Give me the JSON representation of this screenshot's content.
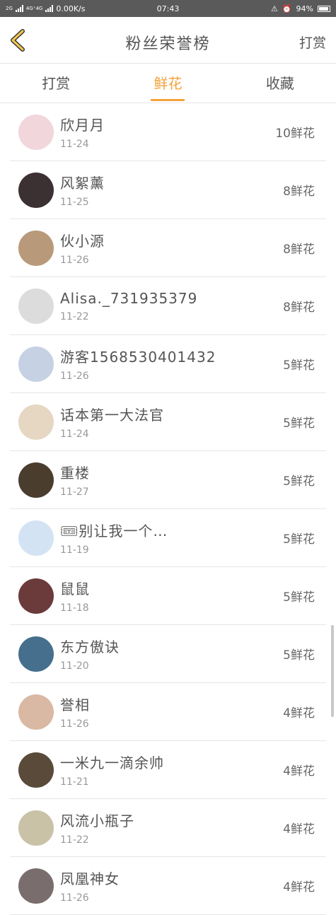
{
  "status_bar": {
    "left_net1": "2G",
    "left_net2": "4G⁺4G",
    "speed": "0.00K/s",
    "time": "07:43",
    "battery": "94%"
  },
  "header": {
    "title": "粉丝荣誉榜",
    "right_link": "打赏"
  },
  "tabs": [
    {
      "label": "打赏",
      "active": false
    },
    {
      "label": "鲜花",
      "active": true
    },
    {
      "label": "收藏",
      "active": false
    }
  ],
  "accent_color": "#f3a23a",
  "rows": [
    {
      "name": "欣月月",
      "date": "11-24",
      "count": "10鲜花",
      "avatar": "#f1d6dc"
    },
    {
      "name": "风絮薰",
      "date": "11-25",
      "count": "8鲜花",
      "avatar": "#3b3032"
    },
    {
      "name": "伙小源",
      "date": "11-26",
      "count": "8鲜花",
      "avatar": "#b89a7a"
    },
    {
      "name": "Alisa._731935379",
      "date": "11-22",
      "count": "8鲜花",
      "avatar": "#dcdcdc"
    },
    {
      "name": "游客1568530401432",
      "date": "11-26",
      "count": "5鲜花",
      "avatar": "#c6d2e3"
    },
    {
      "name": "话本第一大法官",
      "date": "11-24",
      "count": "5鲜花",
      "avatar": "#e6d7c3"
    },
    {
      "name": "重楼",
      "date": "11-27",
      "count": "5鲜花",
      "avatar": "#4a3d2e"
    },
    {
      "name": "🎟别让我一个…",
      "date": "11-19",
      "count": "5鲜花",
      "avatar": "#d3e3f3"
    },
    {
      "name": "鼠鼠",
      "date": "11-18",
      "count": "5鲜花",
      "avatar": "#6b3a3a"
    },
    {
      "name": "东方傲诀",
      "date": "11-20",
      "count": "5鲜花",
      "avatar": "#456f8c"
    },
    {
      "name": "誉相",
      "date": "11-26",
      "count": "4鲜花",
      "avatar": "#d9b9a3"
    },
    {
      "name": "一米九一滴余帅",
      "date": "11-21",
      "count": "4鲜花",
      "avatar": "#5a4a3a"
    },
    {
      "name": "风流小瓶子",
      "date": "11-22",
      "count": "4鲜花",
      "avatar": "#c9c2a7"
    },
    {
      "name": "凤凰神女",
      "date": "11-26",
      "count": "4鲜花",
      "avatar": "#7a6d6d"
    }
  ]
}
